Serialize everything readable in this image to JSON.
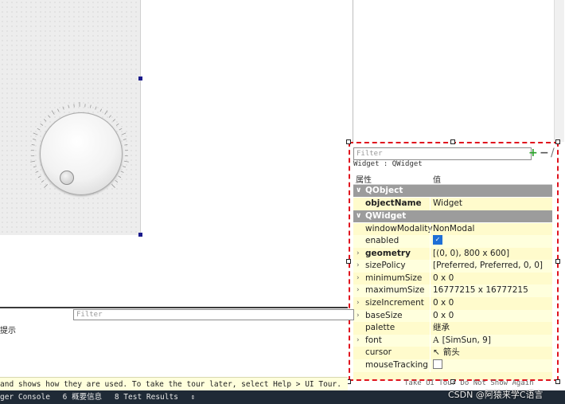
{
  "property_editor": {
    "filter_placeholder": "Filter",
    "add_label": "+",
    "remove_label": "−",
    "wrench_label": "/",
    "object_path": "Widget : QWidget",
    "header_property": "属性",
    "header_value": "值",
    "groups": [
      {
        "label": "QObject"
      },
      {
        "label": "QWidget"
      }
    ],
    "rows": [
      {
        "name": "objectName",
        "value": "Widget"
      },
      {
        "name": "windowModality",
        "value": "NonModal"
      },
      {
        "name": "enabled",
        "value": "checked"
      },
      {
        "name": "geometry",
        "value": "[(0, 0), 800 x 600]"
      },
      {
        "name": "sizePolicy",
        "value": "[Preferred, Preferred, 0, 0]"
      },
      {
        "name": "minimumSize",
        "value": "0 x 0"
      },
      {
        "name": "maximumSize",
        "value": "16777215 x 16777215"
      },
      {
        "name": "sizeIncrement",
        "value": "0 x 0"
      },
      {
        "name": "baseSize",
        "value": "0 x 0"
      },
      {
        "name": "palette",
        "value": "继承"
      },
      {
        "name": "font",
        "value": "[SimSun, 9]",
        "glyph": "A"
      },
      {
        "name": "cursor",
        "value": "箭头",
        "glyph": "↖"
      },
      {
        "name": "mouseTracking",
        "value": "unchecked"
      }
    ]
  },
  "bottom_panel": {
    "filter_placeholder": "Filter",
    "hint_text": "提示"
  },
  "tour_bar": {
    "text": "and shows how they are used. To take the tour later, select Help > UI Tour.",
    "right_text": "Take UI Tour   Do Not Show Again"
  },
  "status_bar": {
    "items": [
      "ger Console",
      "6 概要信息",
      "8 Test Results",
      "⇕"
    ]
  },
  "watermark": "CSDN @阿猿来学C语言",
  "colors": {
    "selection_border": "#e0141e",
    "group_header": "#9c9c9c",
    "row_odd": "#fffbcc",
    "row_even": "#ffffdd",
    "status_bar": "#1f2a36"
  }
}
